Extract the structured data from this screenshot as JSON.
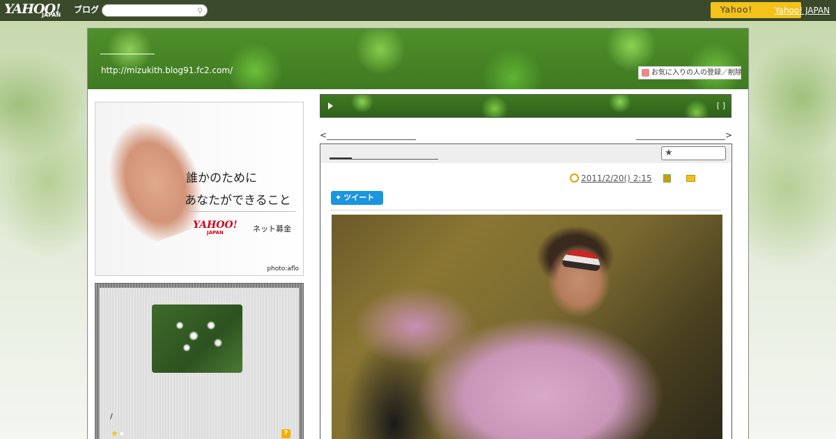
{
  "topbar": {
    "logo_text": "YAHOO!",
    "logo_sub": "JAPAN",
    "logo_blog": "ブログ",
    "search_placeholder": "",
    "yahoo_button_label": "Yahoo!",
    "yahoo_link": "Yahoo! JAPAN"
  },
  "header": {
    "blog_url": "http://mizukith.blog91.fc2.com/",
    "favorite_button": "お気に入りの人の登録／削除"
  },
  "ad": {
    "line1": "誰かのために",
    "line2": "あなたができること",
    "brand": "YAHOO!",
    "brand_sub": "JAPAN",
    "donate": "ネット募金",
    "credit": "photo:aflo"
  },
  "profile": {
    "slash_text": "/",
    "rating": {
      "value": 1,
      "max": 2
    },
    "question_icon": "?"
  },
  "banner": {
    "bracket_text": "[ ]"
  },
  "nav": {
    "prev_symbol": "<",
    "next_symbol": ">"
  },
  "article": {
    "date": "2011/2/20()  2:15",
    "tweet_label": "ツイート"
  },
  "colors": {
    "topbar_bg": "#3b4a2b",
    "yahoo_button": "#f4c21a",
    "tweet_button": "#1b95e0",
    "header_green": "#3f7a22"
  },
  "icons": [
    "search-icon",
    "favorite-icon",
    "play-icon",
    "star-icon",
    "clock-icon",
    "book-icon",
    "folder-icon",
    "twitter-bird-icon",
    "question-icon"
  ]
}
